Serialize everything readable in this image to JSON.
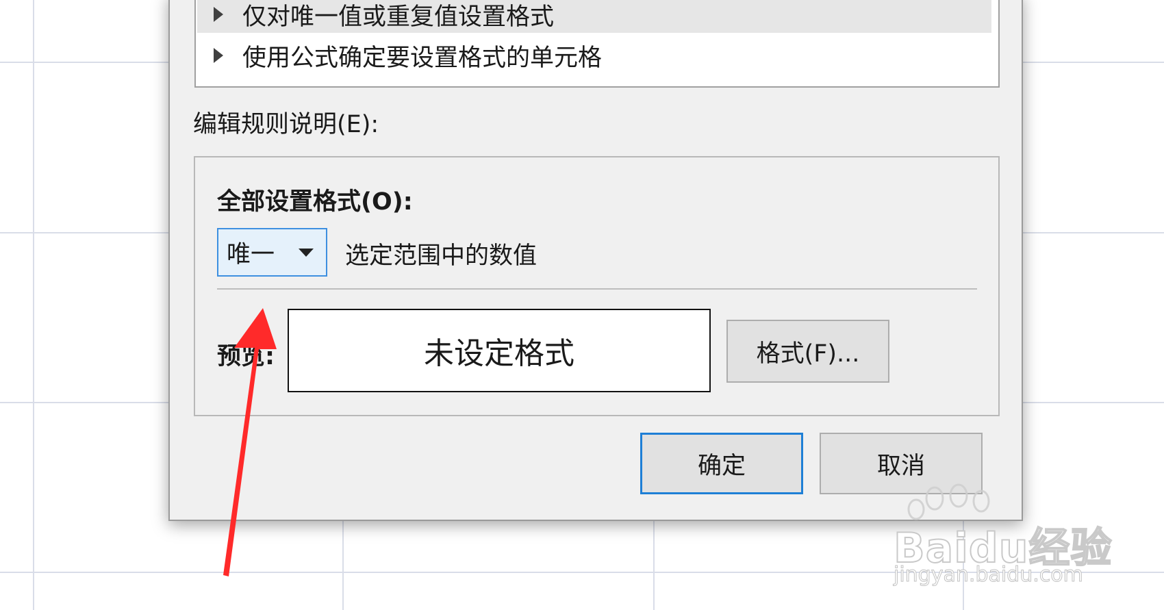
{
  "rules": [
    {
      "label": "仅对唯一值或重复值设置格式",
      "selected": true
    },
    {
      "label": "使用公式确定要设置格式的单元格",
      "selected": false
    }
  ],
  "edit_description_label": "编辑规则说明(E):",
  "format_all_label": "全部设置格式(O):",
  "select_value": "唯一",
  "range_text": "选定范围中的数值",
  "preview_label": "预览:",
  "preview_text": "未设定格式",
  "format_button": "格式(F)...",
  "ok_button": "确定",
  "cancel_button": "取消",
  "watermark": {
    "main": "Baidu经验",
    "sub": "jingyan.baidu.com"
  },
  "colors": {
    "accent": "#1e7fd6",
    "arrow": "#ff2a2a"
  }
}
